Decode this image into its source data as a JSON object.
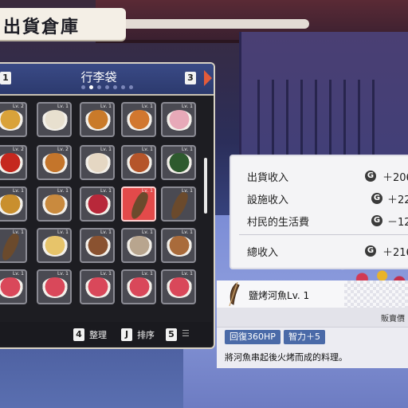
{
  "screen_title": "出貨倉庫",
  "bag": {
    "title": "行李袋",
    "left_key": "1",
    "right_key": "3",
    "page_count": 7,
    "active_page": 1
  },
  "grid": {
    "level_label": "Lv. 1",
    "rows": [
      [
        {
          "item": "bento-feast",
          "level": "Lv. 2"
        },
        {
          "item": "grilled-dango-tray",
          "level": "Lv. 1"
        },
        {
          "item": "fried-chicken",
          "level": "Lv. 1"
        },
        {
          "item": "fried-shrimp",
          "level": "Lv. 1"
        },
        {
          "item": "dango-skewers",
          "level": "Lv. 1"
        }
      ],
      [
        {
          "item": "candied-apple",
          "level": "Lv. 2"
        },
        {
          "item": "karaage",
          "level": "Lv. 2"
        },
        {
          "item": "fruit-bowl",
          "level": "Lv. 1"
        },
        {
          "item": "yakitori-skewers",
          "level": "Lv. 1"
        },
        {
          "item": "sushi-rolls",
          "level": "Lv. 1"
        }
      ],
      [
        {
          "item": "steamed-dish",
          "level": "Lv. 1"
        },
        {
          "item": "yakisoba",
          "level": "Lv. 1"
        },
        {
          "item": "watermelon-plate",
          "level": "Lv. 1"
        },
        {
          "item": "grilled-river-fish",
          "level": "Lv. 1",
          "selected": true
        },
        {
          "item": "grilled-river-fish",
          "level": "Lv. 1"
        }
      ],
      [
        {
          "item": "grilled-river-fish",
          "level": "Lv. 1"
        },
        {
          "item": "oyakodon",
          "level": "Lv. 1"
        },
        {
          "item": "gyudon",
          "level": "Lv. 1"
        },
        {
          "item": "rice-bowl",
          "level": "Lv. 1"
        },
        {
          "item": "dumplings",
          "level": "Lv. 1"
        }
      ],
      [
        {
          "item": "sashimi-set",
          "level": "Lv. 1"
        },
        {
          "item": "sashimi-set",
          "level": "Lv. 1"
        },
        {
          "item": "sashimi-set",
          "level": "Lv. 1"
        },
        {
          "item": "sashimi-set",
          "level": "Lv. 1"
        },
        {
          "item": "sashimi-set",
          "level": "Lv. 1"
        }
      ]
    ]
  },
  "footer": {
    "organize_key": "4",
    "organize_label": "整理",
    "sort_key": "J",
    "sort_label": "排序",
    "extra_key": "5"
  },
  "income": {
    "rows": [
      {
        "label": "出貨收入",
        "value": "＋206"
      },
      {
        "label": "設施收入",
        "value": "＋22"
      },
      {
        "label": "村民的生活費",
        "value": "－12"
      },
      {
        "label": "總收入",
        "value": "＋216"
      }
    ],
    "currency_icon": "G"
  },
  "detail": {
    "name": "鹽烤河魚",
    "level": "Lv. 1",
    "sell_label": "販賣價",
    "tags": [
      "回復360HP",
      "智力＋5"
    ],
    "description": "將河魚串起後火烤而成的料理。"
  },
  "colors": {
    "accent": "#4a6aa8",
    "selected_cell": "#e34a4a",
    "cell_bg": "#4a4a52"
  }
}
